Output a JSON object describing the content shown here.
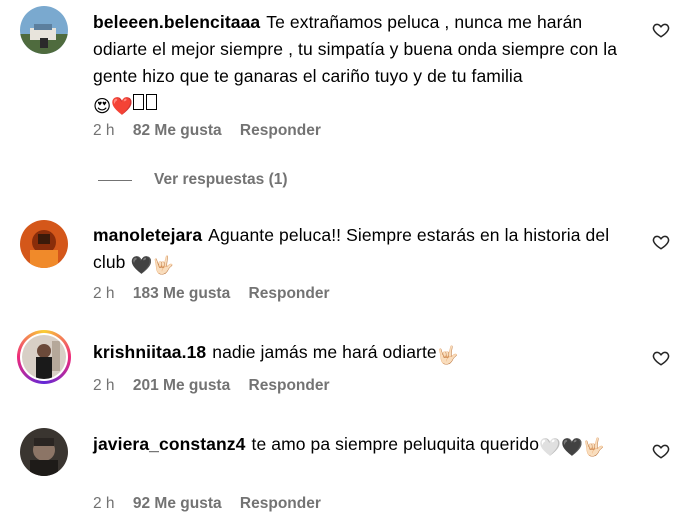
{
  "comments": [
    {
      "username": "beleeen.belencitaaa",
      "text": "Te extrañamos peluca , nunca me harán odiarte el mejor siempre , tu simpatía y buena onda siempre con la gente hizo que te ganaras el cariño tuyo y de tu familia",
      "emojis": "😍❤️",
      "time": "2 h",
      "likes": "82 Me gusta",
      "reply": "Responder"
    },
    {
      "username": "manoletejara",
      "text": "Aguante peluca!! Siempre estarás en la historia del club",
      "emojis": "🖤🤟🏻",
      "time": "2 h",
      "likes": "183 Me gusta",
      "reply": "Responder"
    },
    {
      "username": "krishniitaa.18",
      "text": "nadie jamás me hará odiarte",
      "emojis": "🤟🏻",
      "time": "2 h",
      "likes": "201 Me gusta",
      "reply": "Responder"
    },
    {
      "username": "javiera_constanz4",
      "text": "te amo pa siempre peluquita querido",
      "emojis": "🤍🖤🤟🏻",
      "time": "2 h",
      "likes": "92 Me gusta",
      "reply": "Responder"
    }
  ],
  "view_replies": "Ver respuestas (1)"
}
